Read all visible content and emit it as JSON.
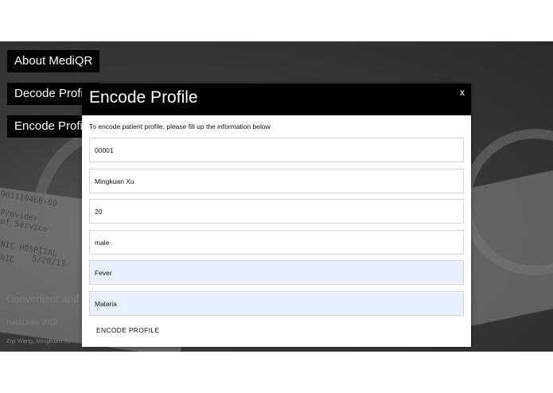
{
  "nav": {
    "about_label": "About MediQR",
    "decode_label": "Decode Profile",
    "encode_label": "Encode Profile"
  },
  "hero": {
    "tagline": "Convenient and",
    "event": "HackDuke 2019",
    "authors": "Ziyi Wang, Mingkuan Xu"
  },
  "background_text": {
    "line1": "961110466-00",
    "line2": "Provider",
    "line3": "of Service",
    "line4": "NIC HOSPITAL",
    "line5": "NIC",
    "line6": "5/20/13-"
  },
  "modal": {
    "title": "Encode Profile",
    "close_label": "x",
    "instructions": "To encode patient profile, please fill up the information below",
    "fields": [
      {
        "value": "00001"
      },
      {
        "value": "Mingkuan Xu"
      },
      {
        "value": "20"
      },
      {
        "value": "male"
      },
      {
        "value": "Fever"
      },
      {
        "value": "Malaria"
      }
    ],
    "submit_label": "ENCODE PROFILE"
  },
  "colors": {
    "header_bg": "#000000",
    "autofill_bg": "#e8f0fe",
    "page_bg": "#ffffff"
  }
}
